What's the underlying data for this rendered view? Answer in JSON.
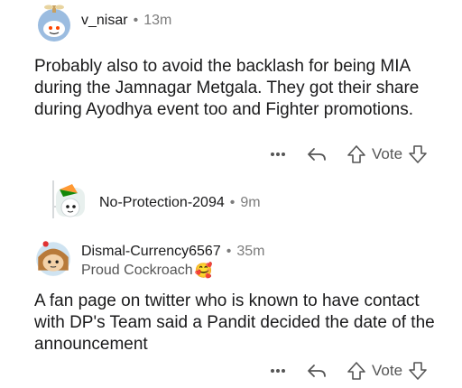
{
  "comments": [
    {
      "username": "v_nisar",
      "age": "13m",
      "body": "Probably also to avoid the backlash for being MIA during the Jamnagar Metgala. They got their share during Ayodhya event too and Fighter promotions.",
      "vote_label": "Vote"
    },
    {
      "username": "No-Protection-2094",
      "age": "9m"
    },
    {
      "username": "Dismal-Currency6567",
      "age": "35m",
      "flair": "Proud Cockroach",
      "flair_emoji": "🥰",
      "body": "A fan page on twitter who is known to have contact with DP's Team said a Pandit decided the date of the announcement",
      "vote_label": "Vote"
    }
  ],
  "icons": {
    "more": "more-options-icon",
    "reply": "reply-icon",
    "upvote": "upvote-icon",
    "downvote": "downvote-icon"
  },
  "colors": {
    "text": "#1a1a1b",
    "meta": "#7c7c7c",
    "thread_line": "#d7dadc",
    "icon": "#555555"
  }
}
